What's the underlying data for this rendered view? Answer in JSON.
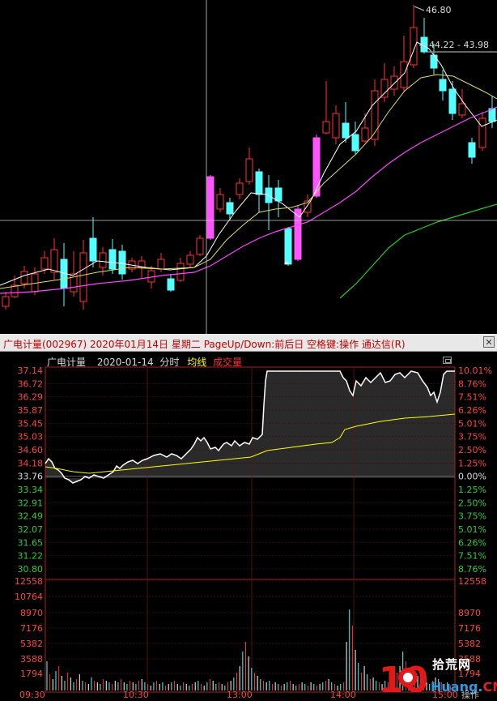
{
  "kline": {
    "high_label": "46.80",
    "ma_label": "44.22 - 43.98"
  },
  "title_bar": {
    "text": "广电计量(002967) 2020年01月14日 星期二 PageUp/Down:前后日 空格键:操作 通达信(R)"
  },
  "panel_header": {
    "stock_name": "广电计量",
    "date": "2020-01-14",
    "period": "分时",
    "avg_line": "均线",
    "volume": "成交量"
  },
  "price_axis": {
    "left_labels": [
      "37.14",
      "36.72",
      "36.29",
      "35.87",
      "35.45",
      "35.03",
      "34.60",
      "34.18",
      "33.76",
      "33.34",
      "32.91",
      "32.49",
      "32.07",
      "31.65",
      "31.22",
      "30.80"
    ],
    "right_labels": [
      "10.01%",
      "8.76%",
      "7.51%",
      "6.26%",
      "5.01%",
      "3.75%",
      "2.50%",
      "1.25%",
      "0.00%",
      "1.25%",
      "2.50%",
      "3.75%",
      "5.01%",
      "6.26%",
      "7.51%",
      "8.76%"
    ]
  },
  "volume_axis": {
    "left_labels": [
      "12558",
      "10764",
      "8970",
      "7176",
      "5382",
      "3588",
      "1794"
    ],
    "right_labels": [
      "12558",
      "8970",
      "7176",
      "5382",
      "3588",
      "1794"
    ]
  },
  "time_axis": [
    "09:30",
    "10:30",
    "13:00",
    "14:00",
    "15:00"
  ],
  "watermark": {
    "number": "10",
    "text": "拾荒网",
    "domain_a": "Huang.",
    "domain_b": "CN"
  },
  "bottom_button": "操作",
  "colors": {
    "up": "#ff3333",
    "down": "#54ffff",
    "limit_up": "#ff55ff",
    "ma5": "#ffffff",
    "ma10": "#ffff55",
    "ma20": "#ff44ff",
    "ma60": "#00cc00",
    "price_line": "#ffffff",
    "avg_line": "#ffff00"
  }
}
